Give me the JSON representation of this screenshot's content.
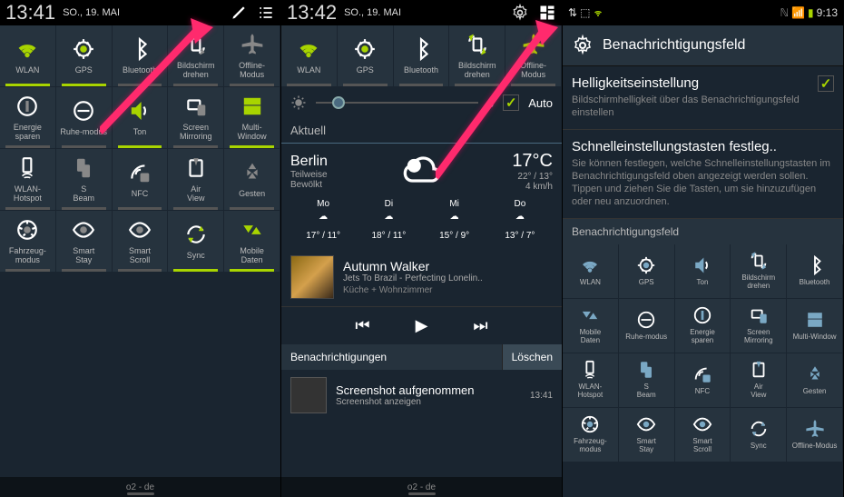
{
  "panel1": {
    "time": "13:41",
    "date": "SO., 19. MAI",
    "carrier": "o2 - de",
    "toggles": [
      {
        "label": "WLAN",
        "on": true
      },
      {
        "label": "GPS",
        "on": true
      },
      {
        "label": "Bluetooth",
        "on": false
      },
      {
        "label": "Bildschirm drehen",
        "on": false
      },
      {
        "label": "Offline-Modus",
        "on": false
      },
      {
        "label": "Energie sparen",
        "on": false
      },
      {
        "label": "Ruhe-modus",
        "on": false
      },
      {
        "label": "Ton",
        "on": true
      },
      {
        "label": "Screen Mirroring",
        "on": false
      },
      {
        "label": "Multi-Window",
        "on": true
      },
      {
        "label": "WLAN-Hotspot",
        "on": false
      },
      {
        "label": "S Beam",
        "on": false
      },
      {
        "label": "NFC",
        "on": false
      },
      {
        "label": "Air View",
        "on": false
      },
      {
        "label": "Gesten",
        "on": false
      },
      {
        "label": "Fahrzeug-modus",
        "on": false
      },
      {
        "label": "Smart Stay",
        "on": false
      },
      {
        "label": "Smart Scroll",
        "on": false
      },
      {
        "label": "Sync",
        "on": true
      },
      {
        "label": "Mobile Daten",
        "on": true
      }
    ]
  },
  "panel2": {
    "time": "13:42",
    "date": "SO., 19. MAI",
    "carrier": "o2 - de",
    "brightness_value": "0",
    "brightness_auto": "Auto",
    "toggles": [
      {
        "label": "WLAN"
      },
      {
        "label": "GPS"
      },
      {
        "label": "Bluetooth"
      },
      {
        "label": "Bildschirm drehen"
      },
      {
        "label": "Offline-Modus"
      }
    ],
    "section_current": "Aktuell",
    "weather": {
      "city": "Berlin",
      "condition_l1": "Teilweise",
      "condition_l2": "Bewölkt",
      "temp": "17°C",
      "hilow": "22° / 13°",
      "wind": "4 km/h",
      "days": [
        {
          "name": "Mo",
          "hi": "17°",
          "lo": "11°"
        },
        {
          "name": "Di",
          "hi": "18°",
          "lo": "11°"
        },
        {
          "name": "Mi",
          "hi": "15°",
          "lo": "9°"
        },
        {
          "name": "Do",
          "hi": "13°",
          "lo": "7°"
        }
      ]
    },
    "music": {
      "title": "Autumn Walker",
      "artist": "Jets To Brazil - Perfecting Lonelin..",
      "room": "Küche + Wohnzimmer"
    },
    "notif_tab": "Benachrichtigungen",
    "notif_clear": "Löschen",
    "notif": {
      "title": "Screenshot aufgenommen",
      "sub": "Screenshot anzeigen",
      "time": "13:41"
    }
  },
  "panel3": {
    "time": "9:13",
    "header": "Benachrichtigungsfeld",
    "brightness_title": "Helligkeitseinstellung",
    "brightness_desc": "Bildschirmhelligkeit über das Benachrichtigungsfeld einstellen",
    "quick_title": "Schnelleinstellungstasten festleg..",
    "quick_desc": "Sie können festlegen, welche Schnelleinstellungstasten im Benachrichtigungsfeld oben angezeigt werden sollen. Tippen und ziehen Sie die Tasten, um sie hinzuzufügen oder neu anzuordnen.",
    "section_label": "Benachrichtigungsfeld",
    "toggles": [
      {
        "label": "WLAN"
      },
      {
        "label": "GPS"
      },
      {
        "label": "Ton"
      },
      {
        "label": "Bildschirm drehen"
      },
      {
        "label": "Bluetooth"
      },
      {
        "label": "Mobile Daten"
      },
      {
        "label": "Ruhe-modus"
      },
      {
        "label": "Energie sparen"
      },
      {
        "label": "Screen Mirroring"
      },
      {
        "label": "Multi-Window"
      },
      {
        "label": "WLAN-Hotspot"
      },
      {
        "label": "S Beam"
      },
      {
        "label": "NFC"
      },
      {
        "label": "Air View"
      },
      {
        "label": "Gesten"
      },
      {
        "label": "Fahrzeug-modus"
      },
      {
        "label": "Smart Stay"
      },
      {
        "label": "Smart Scroll"
      },
      {
        "label": "Sync"
      },
      {
        "label": "Offline-Modus"
      }
    ]
  }
}
